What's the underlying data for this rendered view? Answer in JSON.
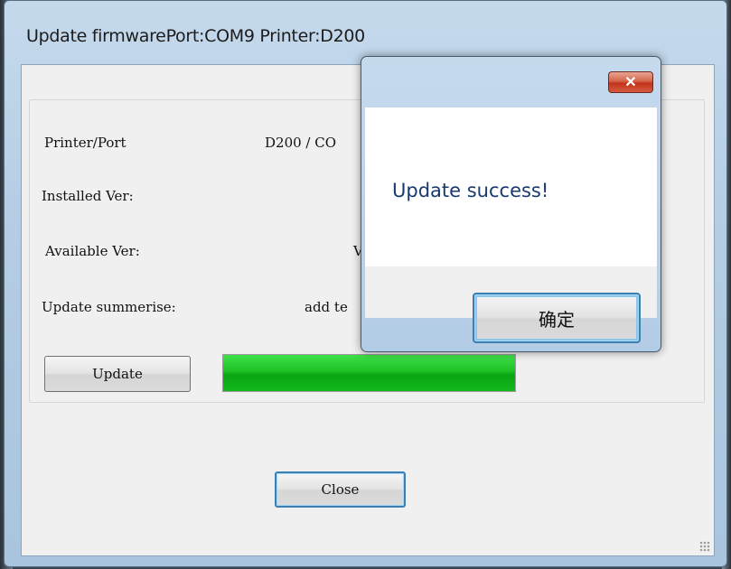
{
  "window": {
    "title": "Update firmwarePort:COM9  Printer:D200"
  },
  "info": {
    "printer_port_label": "Printer/Port",
    "printer_port_value": "D200 / CO",
    "installed_label": "Installed Ver:",
    "available_label": "Available Ver:",
    "available_value": "V",
    "summary_label": "Update summerise:",
    "summary_value": "add te"
  },
  "update_button": "Update",
  "progress": {
    "percent": 100,
    "color": "#13b91c"
  },
  "close_button": "Close",
  "message_box": {
    "text": "Update success!",
    "close_icon": "close-icon",
    "ok_button": "确定"
  }
}
